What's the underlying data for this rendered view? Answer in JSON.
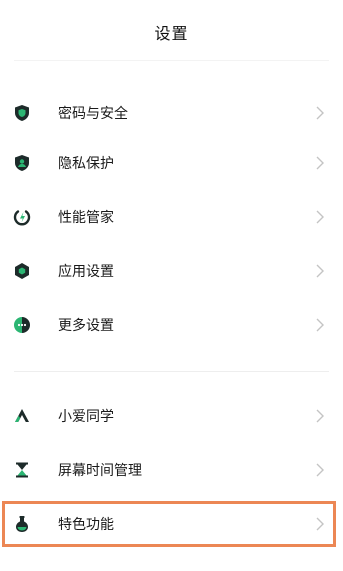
{
  "header": {
    "title": "设置"
  },
  "groups": [
    {
      "items": [
        {
          "label": "密码与安全",
          "icon": "shield-icon"
        },
        {
          "label": "隐私保护",
          "icon": "privacy-icon"
        },
        {
          "label": "性能管家",
          "icon": "performance-icon"
        },
        {
          "label": "应用设置",
          "icon": "app-settings-icon"
        },
        {
          "label": "更多设置",
          "icon": "more-settings-icon"
        }
      ]
    },
    {
      "items": [
        {
          "label": "小爱同学",
          "icon": "xiaoai-icon"
        },
        {
          "label": "屏幕时间管理",
          "icon": "hourglass-icon"
        },
        {
          "label": "特色功能",
          "icon": "flask-icon"
        }
      ]
    }
  ],
  "colors": {
    "icon_dark": "#1d2b2a",
    "icon_accent": "#2bb673",
    "highlight": "#ec8754",
    "chevron": "#c4c4c4"
  }
}
